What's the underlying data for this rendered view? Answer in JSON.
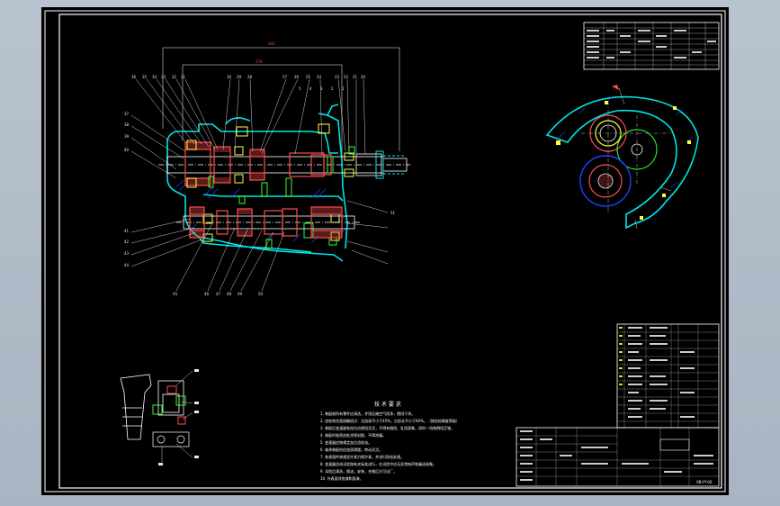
{
  "drawing": {
    "background": "#000000",
    "outer_background": "#b0bac8",
    "colors": {
      "border": "#ffffff",
      "housing": "#00e5e5",
      "gear": "#ff4d4d",
      "shaft": "#ffffff",
      "bearing": "#ffff33",
      "section": "#0000ff",
      "green": "#33ff33",
      "dimension": "#ff4d4d"
    },
    "section_view": {
      "name": "gearbox-longitudinal-section",
      "top_labels": [
        "36",
        "35",
        "34",
        "33",
        "32",
        "31",
        "30",
        "29",
        "28",
        "27",
        "26",
        "25",
        "24",
        "23",
        "22",
        "21",
        "20"
      ],
      "left_labels": [
        "37",
        "38",
        "39",
        "40",
        "41",
        "42"
      ],
      "right_labels": [
        "1",
        "2",
        "3",
        "4",
        "5"
      ],
      "bottom_labels": [
        "43",
        "44",
        "45",
        "46",
        "47",
        "48",
        "49",
        "50",
        "51"
      ],
      "dimension_top": "342",
      "dimension_inner": "276"
    },
    "end_view": {
      "name": "gearbox-cross-section"
    },
    "detail_view": {
      "name": "reverse-idler-detail"
    },
    "technical_notes": {
      "title": "技 术 要 求",
      "lines": [
        "1. 装配前所有零件应清洗，并用压缩空气吹净，擦拭干净。",
        "2. 齿轮啮合面接触斑点：沿齿高不小于45%，沿齿长不小于60%。（按齿轮精度等级）",
        "3. 装配后变速器各挡位应换挡灵活，不得有跳挡、乱挡现象，同时一挡和倒挡互锁。",
        "4. 装配时各密封处涂密封胶，不得渗漏。",
        "5. 变速器应按规定加注齿轮油。",
        "6. 轴承装配时应加润滑脂，转动灵活。",
        "7. 各紧固件按规定拧紧力矩拧紧，并进行防松处理。",
        "8. 变速器总成试验按有关标准进行，在试验中应无异常响声和漏油现象。",
        "9. 试验后清洗，换油，安装，合格后方可出厂。",
        "10. 外表面涂底漆和面漆。"
      ]
    },
    "drawing_number": "XB-YY-00"
  }
}
